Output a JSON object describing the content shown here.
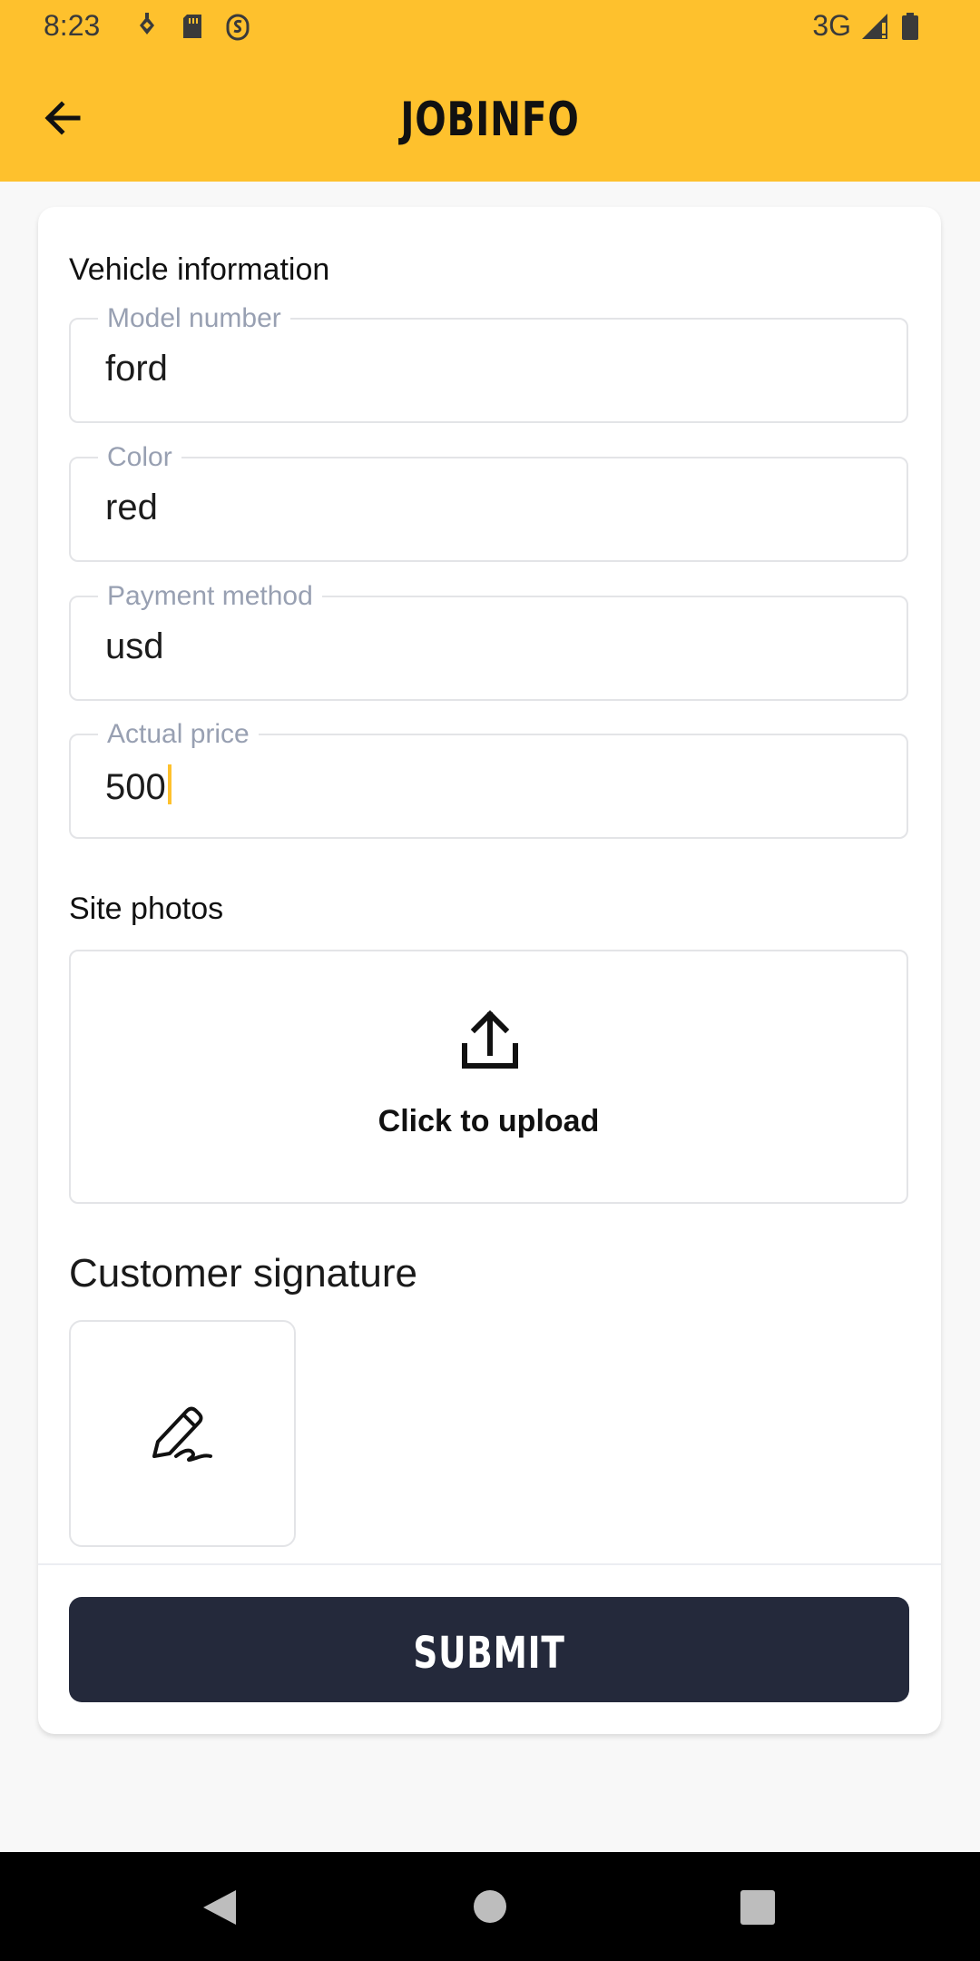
{
  "status_bar": {
    "time": "8:23",
    "network": "3G"
  },
  "app_bar": {
    "title": "JOBINFO",
    "back_icon": "arrow-left-icon"
  },
  "form": {
    "section_title": "Vehicle information",
    "fields": [
      {
        "label": "Model number",
        "value": "ford"
      },
      {
        "label": "Color",
        "value": "red"
      },
      {
        "label": "Payment method",
        "value": "usd"
      },
      {
        "label": "Actual price",
        "value": "500"
      }
    ],
    "photos_title": "Site photos",
    "upload_label": "Click to upload",
    "signature_title": "Customer signature",
    "submit_label": "SUBMIT"
  },
  "colors": {
    "accent": "#fec12d",
    "button": "#24293b",
    "label": "#98a0b2"
  }
}
